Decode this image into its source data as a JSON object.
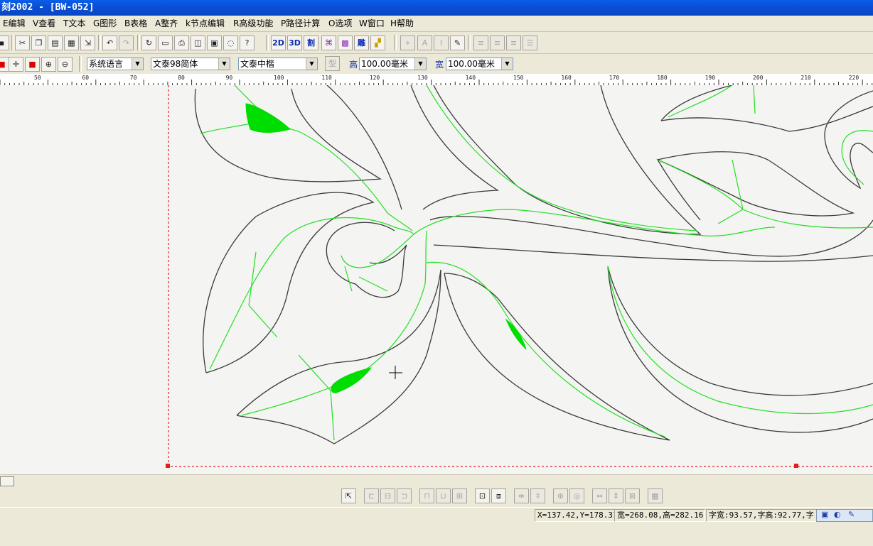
{
  "window": {
    "title": "刻2002 - [BW-052]"
  },
  "menu": [
    {
      "label": "E编辑"
    },
    {
      "label": "V查看"
    },
    {
      "label": "T文本"
    },
    {
      "label": "G图形"
    },
    {
      "label": "B表格"
    },
    {
      "label": "A整齐"
    },
    {
      "label": "k节点编辑"
    },
    {
      "label": "R高级功能"
    },
    {
      "label": "P路径计算"
    },
    {
      "label": "O选项"
    },
    {
      "label": "W窗口"
    },
    {
      "label": "H帮助"
    }
  ],
  "toolbar": {
    "btn_2d": "2D",
    "btn_3d": "3D",
    "btn_cut": "割",
    "btn_engrave": "雕"
  },
  "format": {
    "language": "系统语言",
    "font": "文泰98简体",
    "style": "文泰中楷",
    "type_label": "型",
    "height_label": "高",
    "height_value": "100.00毫米",
    "width_label": "宽",
    "width_value": "100.00毫米"
  },
  "ruler": {
    "ticks": [
      "50",
      "60",
      "70",
      "80",
      "90",
      "100",
      "110",
      "120",
      "130",
      "140",
      "150",
      "160",
      "170",
      "180",
      "190",
      "200",
      "210",
      "220",
      "230"
    ]
  },
  "status": {
    "coords": "X=137.42,Y=178.31",
    "size": "宽=268.08,高=282.16",
    "char": "字宽:93.57,字高:92.77,字"
  },
  "colors": {
    "outline": "#3a3a3a",
    "centerline": "#22e022",
    "fill": "#00dd00",
    "border": "#e02020",
    "titlebar": "#0b4fd6"
  }
}
